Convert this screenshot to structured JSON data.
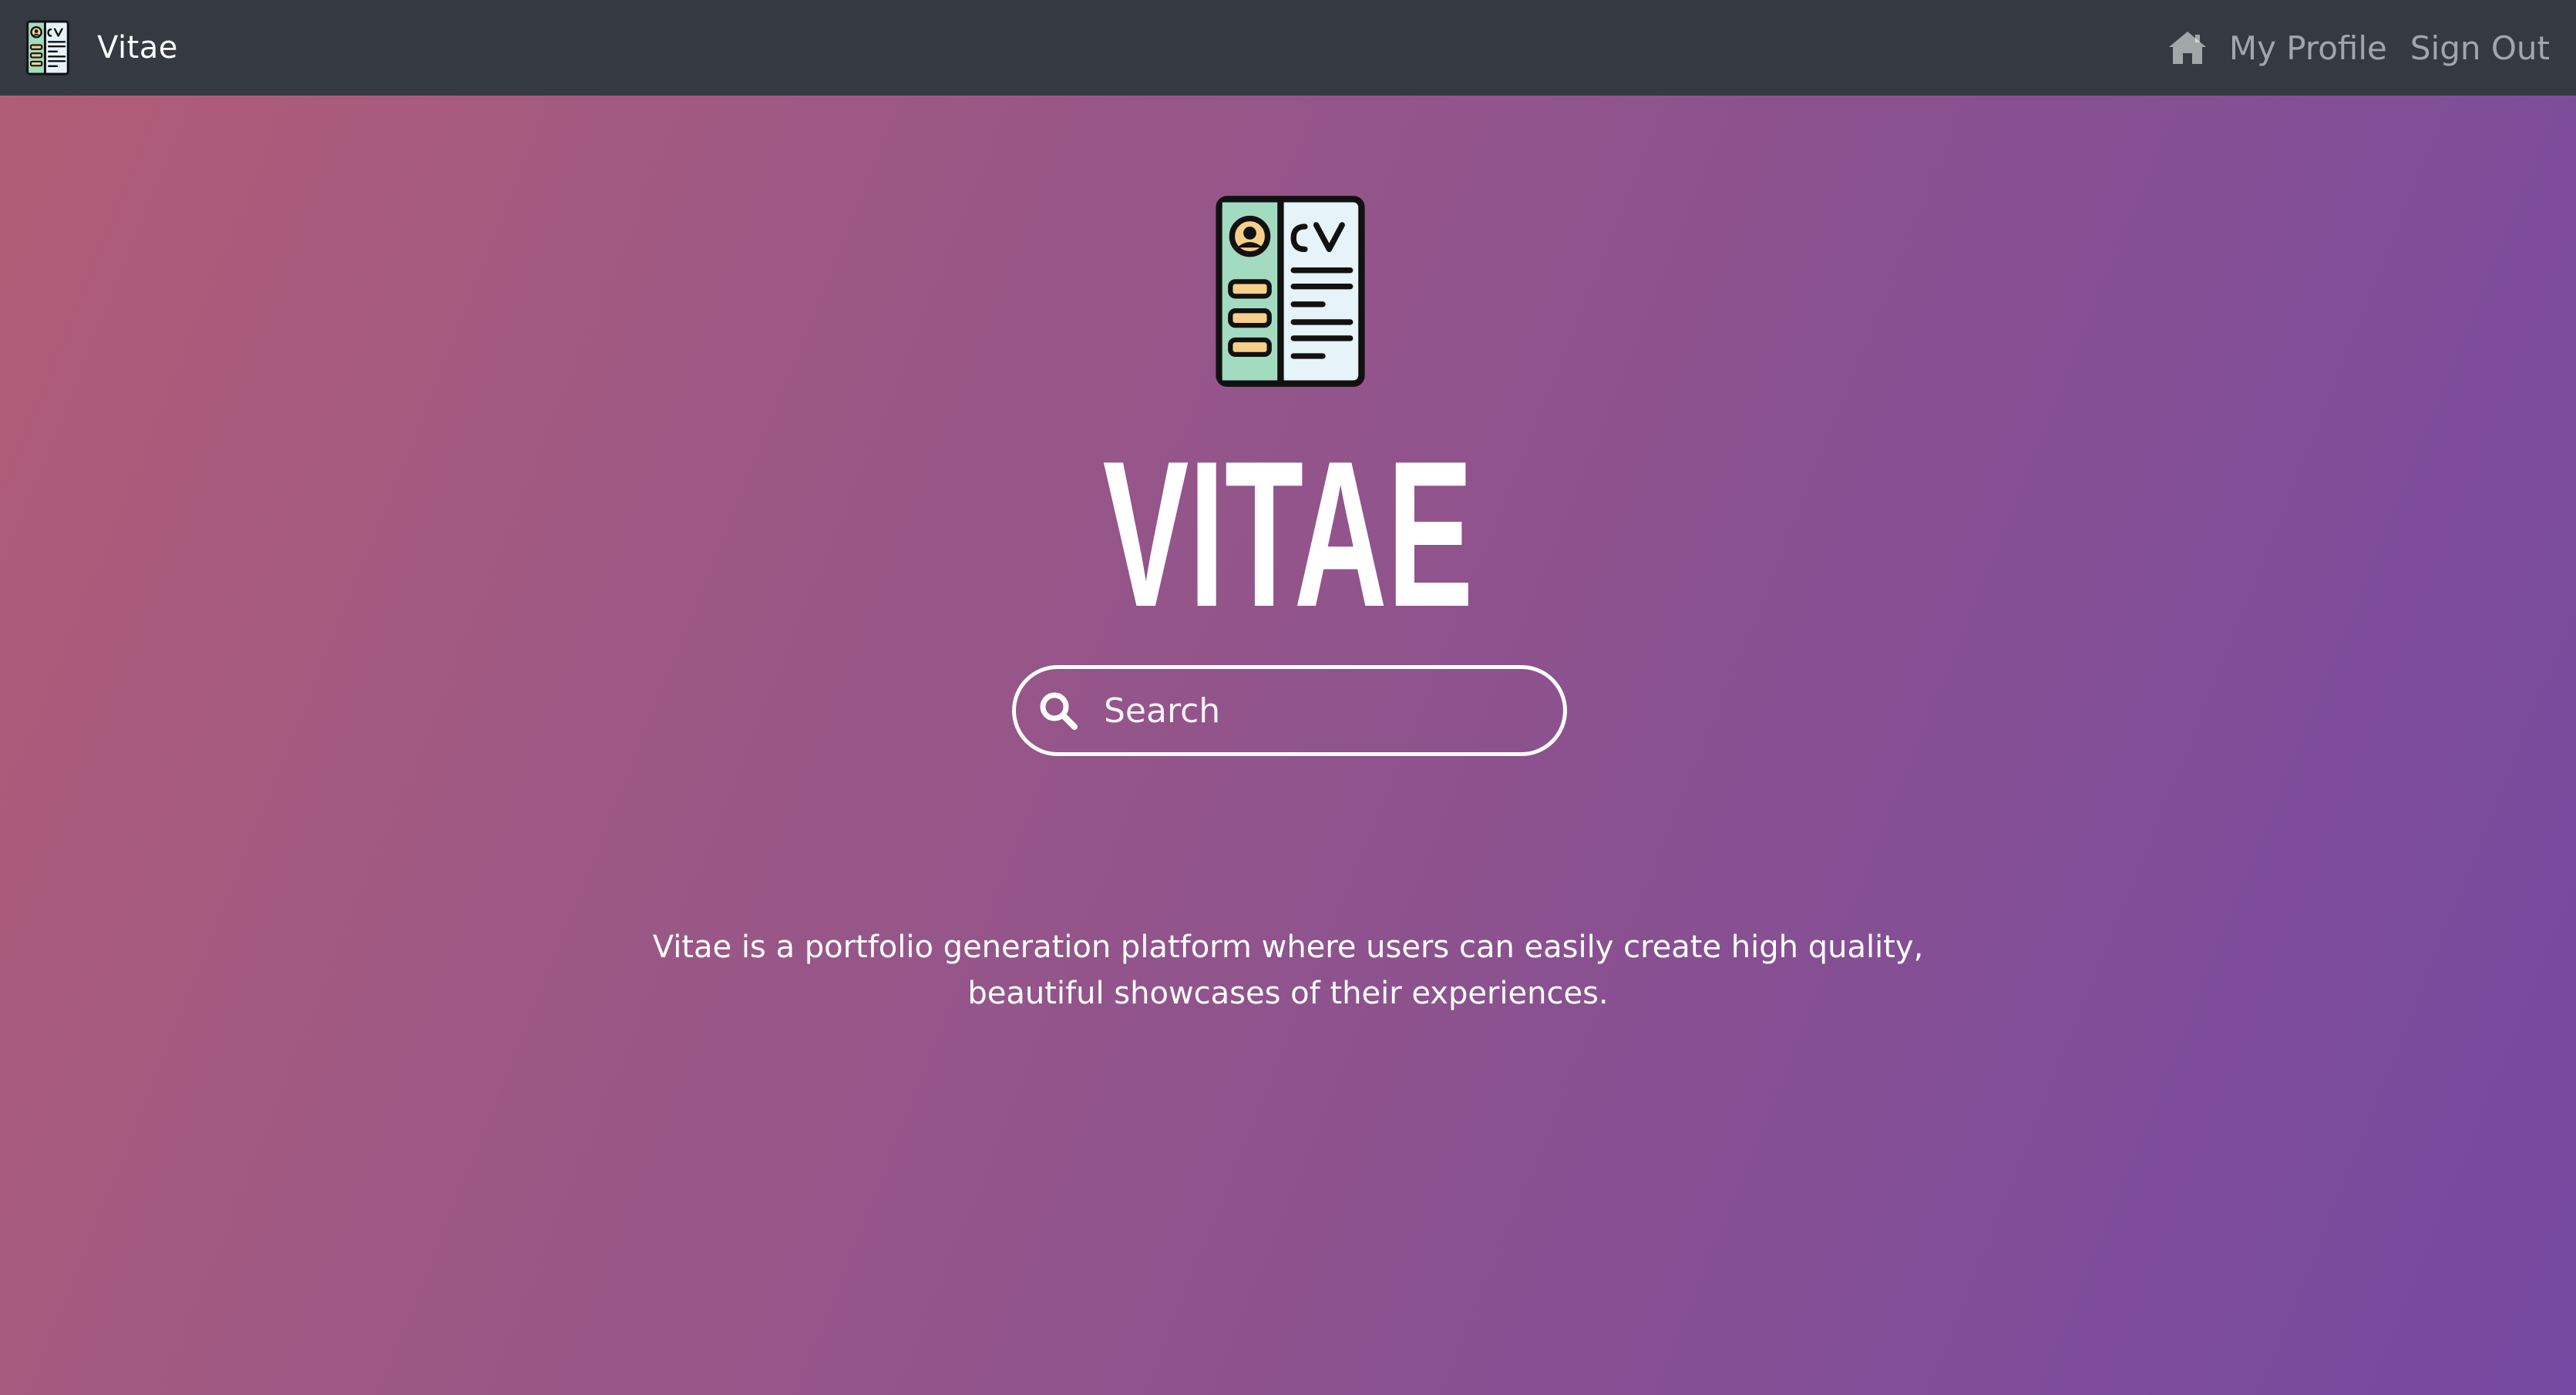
{
  "navbar": {
    "brand_name": "Vitae",
    "brand_logo_icon": "cv-document-icon",
    "home_icon": "home-icon",
    "links": [
      "My Profile",
      "Sign Out"
    ],
    "background_color": "#343a40"
  },
  "hero": {
    "logo_icon": "cv-document-icon",
    "title": "VITAE",
    "search": {
      "icon": "search-icon",
      "placeholder": "Search",
      "value": ""
    },
    "description": "Vitae is a portfolio generation platform where users can easily create high quality, beautiful showcases of their experiences.",
    "gradient_colors": [
      "#b15d76",
      "#9c5885",
      "#8a5190",
      "#7549a1"
    ]
  },
  "logo_colors": {
    "outline": "#111111",
    "left_panel": "#a3dbc1",
    "right_panel": "#e6f3f8",
    "accent": "#f6d08b"
  }
}
